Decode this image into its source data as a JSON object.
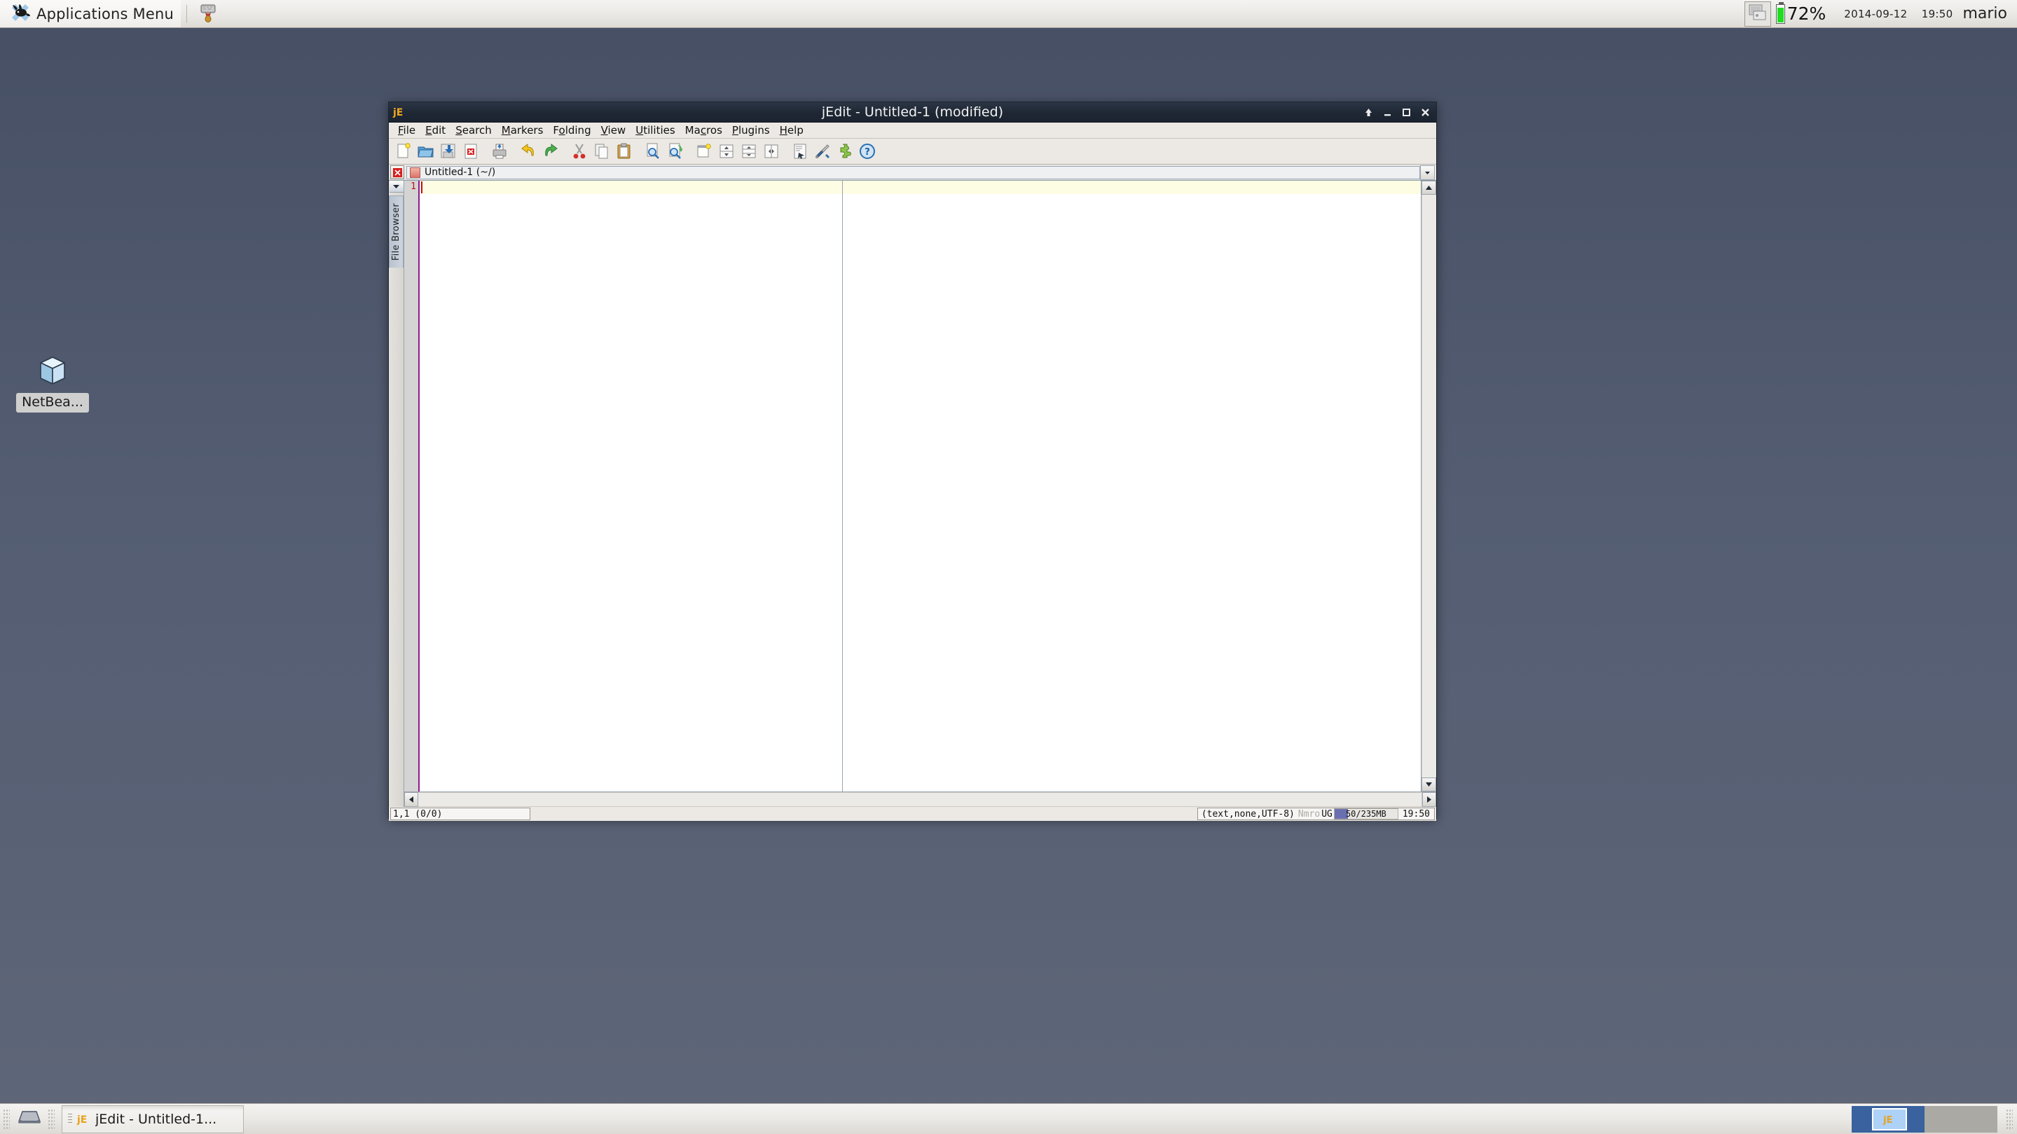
{
  "panel": {
    "applications_menu_label": "Applications Menu",
    "mouse_icon": "xfce-mouse-icon",
    "launcher_icon": "terminal-launcher-icon",
    "display_icon": "display-settings-icon",
    "battery_percent": "72%",
    "battery_level": 80,
    "date": "2014-09-12",
    "time": "19:50",
    "username": "mario"
  },
  "desktop": {
    "icons": [
      {
        "name": "netbeans-icon",
        "label": "NetBea..."
      }
    ]
  },
  "window": {
    "title": "jEdit - Untitled-1 (modified)",
    "app_icon": "jedit-icon",
    "controls": {
      "shade": "shade-button",
      "minimize": "minimize-button",
      "maximize": "maximize-button",
      "close": "close-button"
    },
    "menubar": [
      {
        "label": "File",
        "mnemonic": "F"
      },
      {
        "label": "Edit",
        "mnemonic": "E"
      },
      {
        "label": "Search",
        "mnemonic": "S"
      },
      {
        "label": "Markers",
        "mnemonic": "M"
      },
      {
        "label": "Folding",
        "mnemonic": "o"
      },
      {
        "label": "View",
        "mnemonic": "V"
      },
      {
        "label": "Utilities",
        "mnemonic": "U"
      },
      {
        "label": "Macros",
        "mnemonic": "c"
      },
      {
        "label": "Plugins",
        "mnemonic": "P"
      },
      {
        "label": "Help",
        "mnemonic": "H"
      }
    ],
    "toolbar": [
      {
        "name": "new-file-icon",
        "tip": "New File"
      },
      {
        "name": "open-file-icon",
        "tip": "Open File"
      },
      {
        "name": "save-icon",
        "tip": "Save"
      },
      {
        "name": "close-file-icon",
        "tip": "Close File"
      },
      {
        "sep": true
      },
      {
        "name": "print-icon",
        "tip": "Print"
      },
      {
        "sep": true
      },
      {
        "name": "undo-icon",
        "tip": "Undo"
      },
      {
        "name": "redo-icon",
        "tip": "Redo"
      },
      {
        "sep": true
      },
      {
        "name": "cut-icon",
        "tip": "Cut"
      },
      {
        "name": "copy-icon",
        "tip": "Copy"
      },
      {
        "name": "paste-icon",
        "tip": "Paste"
      },
      {
        "sep": true
      },
      {
        "name": "find-icon",
        "tip": "Find"
      },
      {
        "name": "find-next-icon",
        "tip": "Find Next"
      },
      {
        "sep": true
      },
      {
        "name": "new-view-icon",
        "tip": "New View"
      },
      {
        "name": "split-horizontal-icon",
        "tip": "Split Horizontally"
      },
      {
        "name": "split-vertical-icon",
        "tip": "Split Vertically"
      },
      {
        "name": "unsplit-icon",
        "tip": "Unsplit"
      },
      {
        "sep": true
      },
      {
        "name": "paste-previous-icon",
        "tip": "Paste Previous"
      },
      {
        "name": "global-options-icon",
        "tip": "Global Options"
      },
      {
        "name": "plugin-manager-icon",
        "tip": "Plugin Manager"
      },
      {
        "name": "help-icon",
        "tip": "Help"
      }
    ],
    "bufferbar": {
      "close_label": "x",
      "buffer_name": "Untitled-1 (~/)",
      "dropdown_arrow": "chevron-down-icon"
    },
    "dock": {
      "toggle_icon": "chevron-down-icon",
      "file_browser_label": "File Browser"
    },
    "editor": {
      "line_number": "1",
      "content": ""
    },
    "statusbar": {
      "caret": "1,1 (0/0)",
      "mode": "(text,none,UTF-8)",
      "flags_off": "Nmro",
      "flags_on": "UG",
      "memory": "50/235MB",
      "memory_used_percent": 21,
      "clock": "19:50"
    }
  },
  "taskbar": {
    "show_desktop_icon": "show-desktop-icon",
    "tasks": [
      {
        "icon": "jedit-icon",
        "label": "jEdit - Untitled-1..."
      }
    ],
    "workspaces": [
      {
        "name": "workspace-1",
        "active": true,
        "has_window": true
      },
      {
        "name": "workspace-2",
        "active": false,
        "has_window": false
      }
    ]
  },
  "colors": {
    "desktop_top": "#464f64",
    "desktop_bottom": "#5e6678",
    "titlebar": "#1e2733",
    "accent_purple": "#8e1a8e",
    "current_line": "#fdfde4",
    "battery_green": "#22dd22",
    "workspace_active": "#39629e",
    "memory_fill": "#6a6fb0"
  }
}
